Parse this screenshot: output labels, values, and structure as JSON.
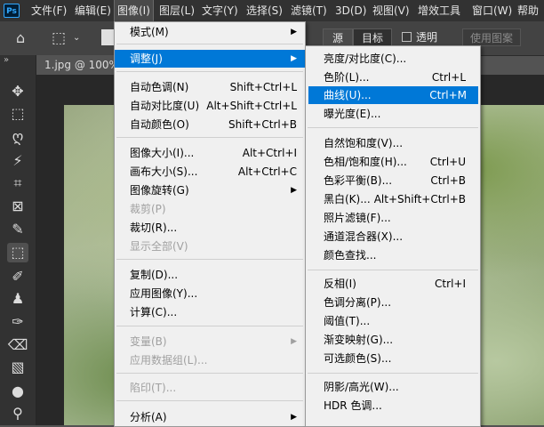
{
  "app": {
    "logo": "Ps"
  },
  "menubar": [
    {
      "label": "文件(F)"
    },
    {
      "label": "编辑(E)"
    },
    {
      "label": "图像(I)"
    },
    {
      "label": "图层(L)"
    },
    {
      "label": "文字(Y)"
    },
    {
      "label": "选择(S)"
    },
    {
      "label": "滤镜(T)"
    },
    {
      "label": "3D(D)"
    },
    {
      "label": "视图(V)"
    },
    {
      "label": "增效工具"
    },
    {
      "label": "窗口(W)"
    },
    {
      "label": "帮助"
    }
  ],
  "options_bar": {
    "source": "源",
    "target": "目标",
    "transparent": "透明",
    "use_pattern": "使用图案"
  },
  "document": {
    "tab_title": "1.jpg @ 100%("
  },
  "toolbar": {
    "collapse": "»",
    "tools": [
      "move-icon",
      "marquee-icon",
      "lasso-icon",
      "magic-wand-icon",
      "crop-icon",
      "frame-icon",
      "eyedropper-icon",
      "patch-icon",
      "brush-icon",
      "stamp-icon",
      "history-brush-icon",
      "eraser-icon",
      "gradient-icon",
      "blur-icon",
      "dodge-icon"
    ]
  },
  "image_menu": {
    "items": [
      {
        "label": "模式(M)",
        "shortcut": "",
        "arrow": "▶"
      },
      {
        "label": "调整(J)",
        "shortcut": "",
        "arrow": "▶"
      },
      {
        "label": "自动色调(N)",
        "shortcut": "Shift+Ctrl+L"
      },
      {
        "label": "自动对比度(U)",
        "shortcut": "Alt+Shift+Ctrl+L"
      },
      {
        "label": "自动颜色(O)",
        "shortcut": "Shift+Ctrl+B"
      },
      {
        "label": "图像大小(I)...",
        "shortcut": "Alt+Ctrl+I"
      },
      {
        "label": "画布大小(S)...",
        "shortcut": "Alt+Ctrl+C"
      },
      {
        "label": "图像旋转(G)",
        "shortcut": "",
        "arrow": "▶"
      },
      {
        "label": "裁剪(P)",
        "shortcut": ""
      },
      {
        "label": "裁切(R)...",
        "shortcut": ""
      },
      {
        "label": "显示全部(V)",
        "shortcut": ""
      },
      {
        "label": "复制(D)...",
        "shortcut": ""
      },
      {
        "label": "应用图像(Y)...",
        "shortcut": ""
      },
      {
        "label": "计算(C)...",
        "shortcut": ""
      },
      {
        "label": "变量(B)",
        "shortcut": "",
        "arrow": "▶"
      },
      {
        "label": "应用数据组(L)...",
        "shortcut": ""
      },
      {
        "label": "陷印(T)...",
        "shortcut": ""
      },
      {
        "label": "分析(A)",
        "shortcut": "",
        "arrow": "▶"
      }
    ]
  },
  "adjust_menu": {
    "items": [
      {
        "label": "亮度/对比度(C)...",
        "shortcut": ""
      },
      {
        "label": "色阶(L)...",
        "shortcut": "Ctrl+L"
      },
      {
        "label": "曲线(U)...",
        "shortcut": "Ctrl+M"
      },
      {
        "label": "曝光度(E)...",
        "shortcut": ""
      },
      {
        "label": "自然饱和度(V)...",
        "shortcut": ""
      },
      {
        "label": "色相/饱和度(H)...",
        "shortcut": "Ctrl+U"
      },
      {
        "label": "色彩平衡(B)...",
        "shortcut": "Ctrl+B"
      },
      {
        "label": "黑白(K)...",
        "shortcut": "Alt+Shift+Ctrl+B"
      },
      {
        "label": "照片滤镜(F)...",
        "shortcut": ""
      },
      {
        "label": "通道混合器(X)...",
        "shortcut": ""
      },
      {
        "label": "颜色查找...",
        "shortcut": ""
      },
      {
        "label": "反相(I)",
        "shortcut": "Ctrl+I"
      },
      {
        "label": "色调分离(P)...",
        "shortcut": ""
      },
      {
        "label": "阈值(T)...",
        "shortcut": ""
      },
      {
        "label": "渐变映射(G)...",
        "shortcut": ""
      },
      {
        "label": "可选颜色(S)...",
        "shortcut": ""
      },
      {
        "label": "阴影/高光(W)...",
        "shortcut": ""
      },
      {
        "label": "HDR 色调...",
        "shortcut": ""
      }
    ]
  }
}
